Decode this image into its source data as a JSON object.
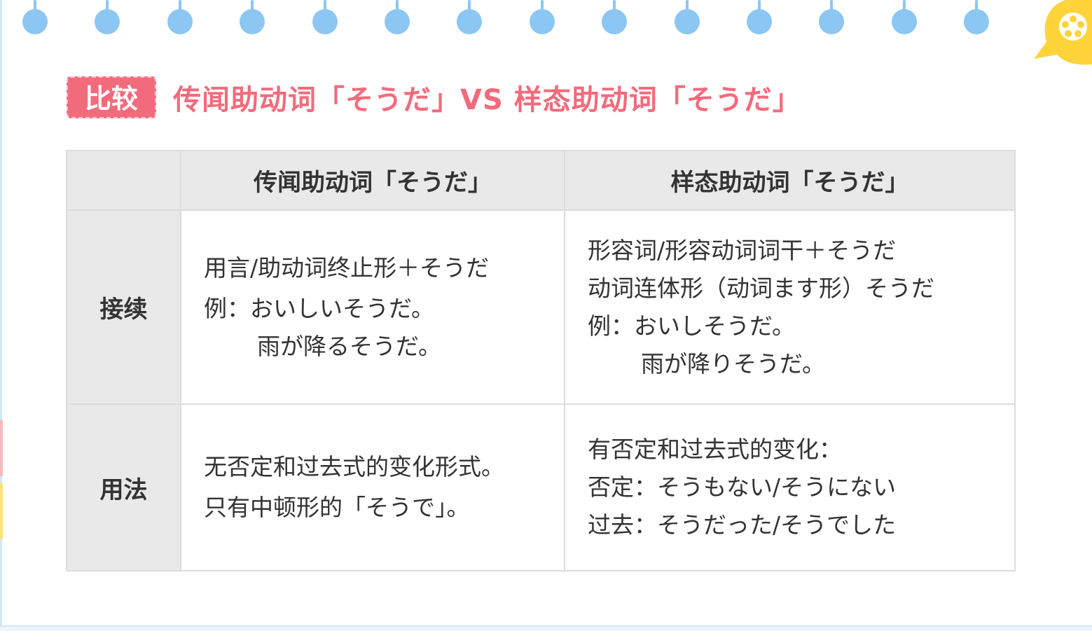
{
  "title": {
    "tag": "比较",
    "text": "传闻助动词「そうだ」VS 样态助动词「そうだ」"
  },
  "table": {
    "headers": [
      "",
      "传闻助动词「そうだ」",
      "样态助动词「そうだ」"
    ],
    "rows": [
      {
        "label": "接续",
        "hearsay": [
          "用言/助动词终止形＋そうだ",
          "例：おいしいそうだ。",
          "雨が降るそうだ。"
        ],
        "appearance": [
          "形容词/形容动词词干＋そうだ",
          "动词连体形（动词ます形）そうだ",
          "例：おいしそうだ。",
          "雨が降りそうだ。"
        ]
      },
      {
        "label": "用法",
        "hearsay": [
          "无否定和过去式的变化形式。",
          "只有中顿形的「そうで」。"
        ],
        "appearance": [
          "有否定和过去式的变化：",
          "否定：そうもない/そうにない",
          "过去：そうだった/そうでした"
        ]
      }
    ]
  },
  "colors": {
    "accent": "#f26b7c",
    "ring": "#8cc6f2",
    "header_bg": "#e9e9e9",
    "deco_yellow": "#ffd43b"
  },
  "icons": [
    "ring-hole-icon",
    "flower-badge-icon"
  ]
}
